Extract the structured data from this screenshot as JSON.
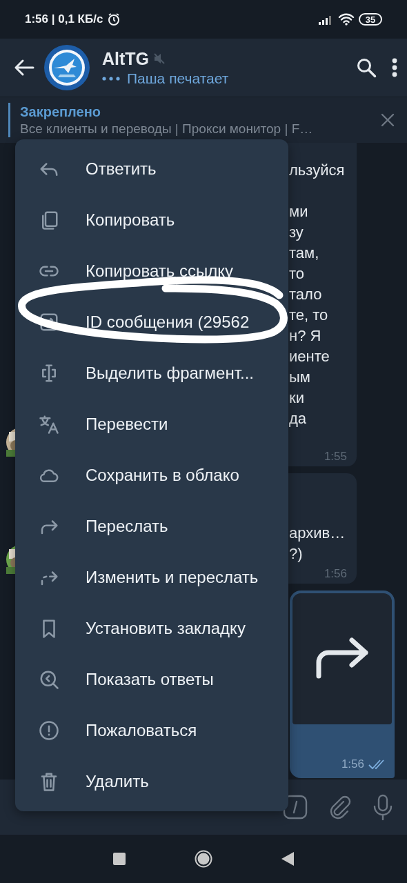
{
  "status_bar": {
    "text": "1:56 | 0,1 КБ/с",
    "battery": "35"
  },
  "header": {
    "title": "AltTG",
    "muted": true,
    "status": "Паша печатает"
  },
  "pinned": {
    "label": "Закреплено",
    "text": "Все клиенты и переводы | Прокси монитор | F…"
  },
  "messages": [
    {
      "kind": "incoming",
      "paragraphs": [
        [
          "льзуйся"
        ],
        [
          "ми",
          "зу",
          "там,",
          "то",
          "тало",
          "те, то",
          "н? Я",
          "иенте",
          "ым",
          "ки",
          "да"
        ]
      ],
      "time": "1:55"
    },
    {
      "kind": "incoming",
      "paragraphs": [
        [
          "архив…",
          "?)"
        ]
      ],
      "time": "1:56"
    },
    {
      "kind": "outgoing",
      "time": "1:56",
      "read": true
    }
  ],
  "context_menu": [
    {
      "kind": "reply",
      "label": "Ответить"
    },
    {
      "kind": "copy",
      "label": "Копировать"
    },
    {
      "kind": "link",
      "label": "Копировать ссылку"
    },
    {
      "kind": "id",
      "label": "ID сообщения (29562"
    },
    {
      "kind": "select",
      "label": "Выделить фрагмент..."
    },
    {
      "kind": "translate",
      "label": "Перевести"
    },
    {
      "kind": "cloud",
      "label": "Сохранить в облако"
    },
    {
      "kind": "forward",
      "label": "Переслать"
    },
    {
      "kind": "edit_forward",
      "label": "Изменить и переслать"
    },
    {
      "kind": "bookmark",
      "label": "Установить закладку"
    },
    {
      "kind": "replies",
      "label": "Показать ответы"
    },
    {
      "kind": "report",
      "label": "Пожаловаться"
    },
    {
      "kind": "delete",
      "label": "Удалить"
    }
  ]
}
